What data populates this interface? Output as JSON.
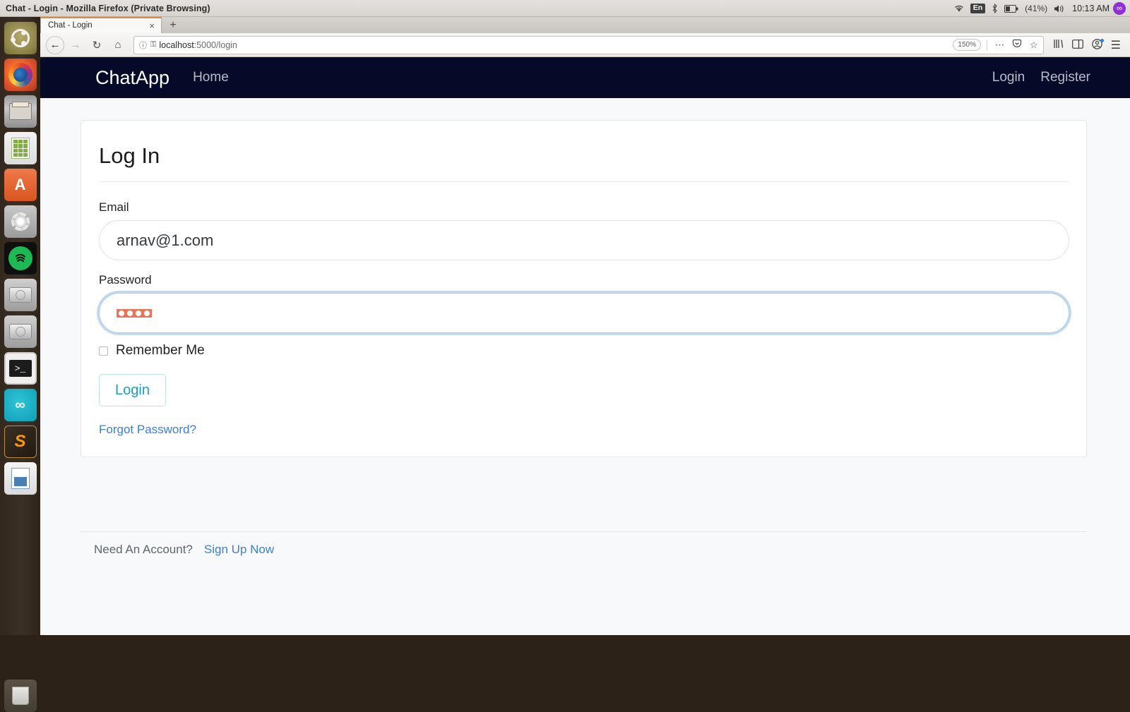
{
  "os": {
    "window_title": "Chat - Login - Mozilla Firefox (Private Browsing)",
    "tray": {
      "wifi_icon": "wifi-icon",
      "language": "En",
      "bluetooth_icon": "bluetooth-icon",
      "battery_icon": "battery-icon",
      "battery_level": "(41%)",
      "volume_icon": "volume-icon",
      "clock": "10:13 AM",
      "settings_icon": "gear-icon"
    },
    "launcher": [
      {
        "name": "ubuntu-dash",
        "label": "Ubuntu Dash"
      },
      {
        "name": "firefox",
        "label": "Firefox"
      },
      {
        "name": "files",
        "label": "Files"
      },
      {
        "name": "libreoffice-calc",
        "label": "LibreOffice Calc"
      },
      {
        "name": "ubuntu-software",
        "label": "Ubuntu Software",
        "glyph": "A"
      },
      {
        "name": "system-settings",
        "label": "System Settings"
      },
      {
        "name": "spotify",
        "label": "Spotify"
      },
      {
        "name": "disk-1",
        "label": "Disk"
      },
      {
        "name": "disk-2",
        "label": "Disk"
      },
      {
        "name": "terminal",
        "label": "Terminal",
        "glyph": ">_"
      },
      {
        "name": "arduino",
        "label": "Arduino",
        "glyph": "∞"
      },
      {
        "name": "sublime-text",
        "label": "Sublime Text",
        "glyph": "S"
      },
      {
        "name": "libreoffice-impress",
        "label": "LibreOffice Impress"
      },
      {
        "name": "trash",
        "label": "Trash"
      }
    ]
  },
  "browser": {
    "tab": {
      "title": "Chat - Login",
      "close_label": "×"
    },
    "new_tab_label": "+",
    "back_icon": "←",
    "forward_icon": "→",
    "reload_icon": "↻",
    "home_icon": "⌂",
    "url": {
      "info_icon": "ⓘ",
      "key_icon": "⚿",
      "host": "localhost",
      "path": ":5000/login"
    },
    "zoom_level": "150%",
    "page_actions_icon": "⋯",
    "pocket_icon": "pocket-icon",
    "bookmark_icon": "☆",
    "library_icon": "library-icon",
    "sidebar_icon": "sidebar-icon",
    "account_icon": "account-icon",
    "menu_icon": "☰"
  },
  "site": {
    "navbar": {
      "brand": "ChatApp",
      "left_links": [
        {
          "label": "Home"
        }
      ],
      "right_links": [
        {
          "label": "Login"
        },
        {
          "label": "Register"
        }
      ]
    },
    "form": {
      "title": "Log In",
      "email": {
        "label": "Email",
        "value": "arnav@1.com",
        "placeholder": ""
      },
      "password": {
        "label": "Password",
        "value": "••••",
        "mask_dots": 4,
        "focused": true,
        "selected": true
      },
      "remember": {
        "label": "Remember Me",
        "checked": false
      },
      "submit_label": "Login",
      "forgot_label": "Forgot Password?"
    },
    "footer": {
      "text": "Need An Account?",
      "link_label": "Sign Up Now"
    },
    "colors": {
      "navbar_bg": "#040a28",
      "page_bg": "#f8f9fa",
      "link": "#3a7fd5",
      "button_accent": "#17a2b8",
      "focus_ring": "#a9cdec",
      "selection": "#e8745a"
    }
  }
}
